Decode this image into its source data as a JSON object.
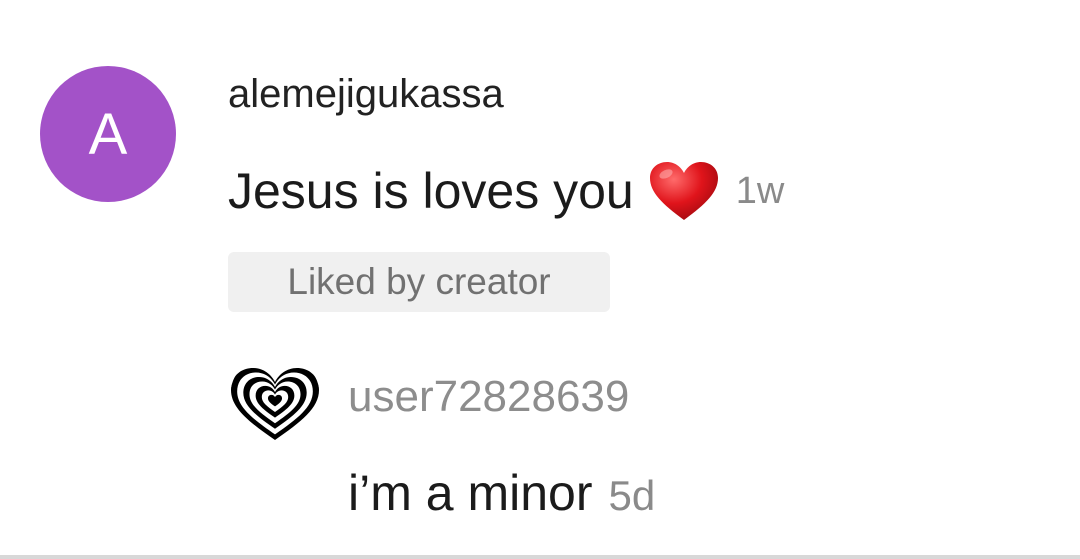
{
  "comments": [
    {
      "avatar_letter": "A",
      "avatar_color": "#a352c8",
      "username": "alemejigukassa",
      "text": "Jesus is loves you",
      "emoji": "red-heart-emoji",
      "time": "1w",
      "badge": "Liked by creator"
    },
    {
      "avatar_icon": "hypnotic-heart-icon",
      "username": "user72828639",
      "text": "i’m a minor",
      "time": "5d"
    }
  ]
}
